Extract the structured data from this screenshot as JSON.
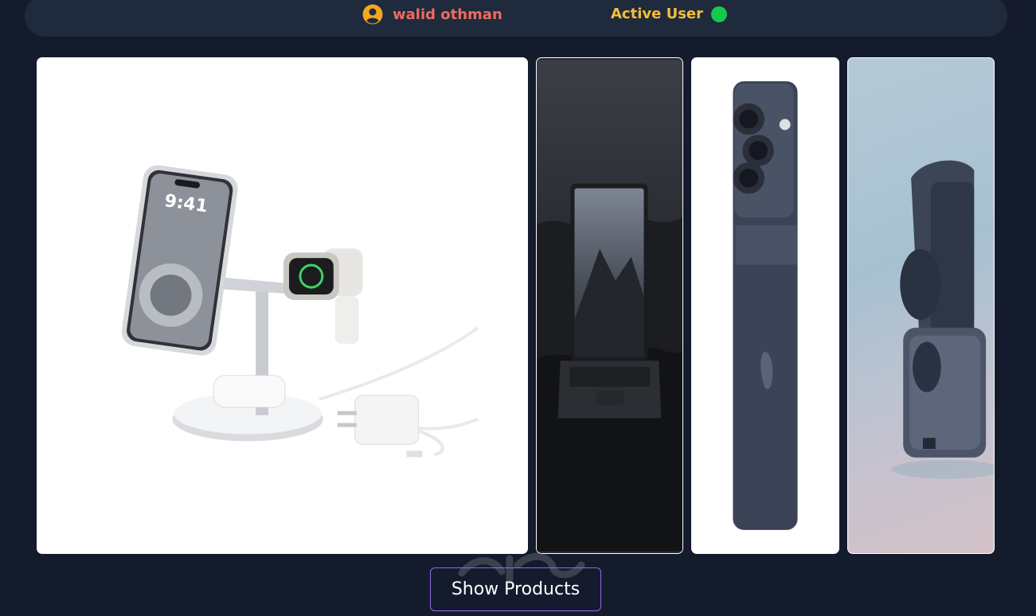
{
  "header": {
    "user_name": "walid othman",
    "user_icon": "user-circle-icon",
    "status_label": "Active User",
    "status_color": "#14c94b"
  },
  "gallery": {
    "items": [
      {
        "subject": "3-in-1 wireless charging stand with phone, watch, earbuds and charger"
      },
      {
        "subject": "laptop on dark foliage"
      },
      {
        "subject": "smartphone back with triple camera"
      },
      {
        "subject": "wireless earbuds in open charging case"
      }
    ]
  },
  "actions": {
    "show_products_label": "Show Products"
  },
  "colors": {
    "background": "#141b2d",
    "header_bar": "#1f2a3d",
    "user_name": "#ef6b5f",
    "status_text": "#f6bd3a",
    "button_border": "#9a67e8"
  }
}
